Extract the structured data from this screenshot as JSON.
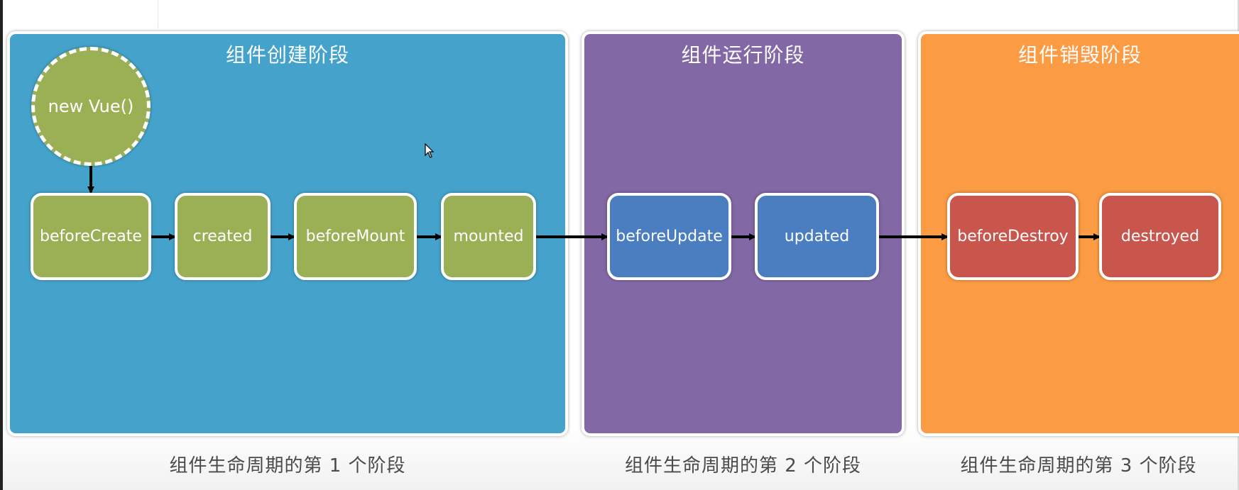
{
  "diagram": {
    "phases": [
      {
        "title": "组件创建阶段",
        "caption": "组件生命周期的第 1 个阶段",
        "color": "#45a3cb"
      },
      {
        "title": "组件运行阶段",
        "caption": "组件生命周期的第 2 个阶段",
        "color": "#8268a4"
      },
      {
        "title": "组件销毁阶段",
        "caption": "组件生命周期的第 3 个阶段",
        "color": "#fb9b43"
      }
    ],
    "start_node": "new Vue()",
    "hooks": [
      {
        "label": "beforeCreate",
        "color": "#9bb055"
      },
      {
        "label": "created",
        "color": "#9bb055"
      },
      {
        "label": "beforeMount",
        "color": "#9bb055"
      },
      {
        "label": "mounted",
        "color": "#9bb055"
      },
      {
        "label": "beforeUpdate",
        "color": "#4a7ec1"
      },
      {
        "label": "updated",
        "color": "#4a7ec1"
      },
      {
        "label": "beforeDestroy",
        "color": "#c9564c"
      },
      {
        "label": "destroyed",
        "color": "#c9564c"
      }
    ]
  }
}
